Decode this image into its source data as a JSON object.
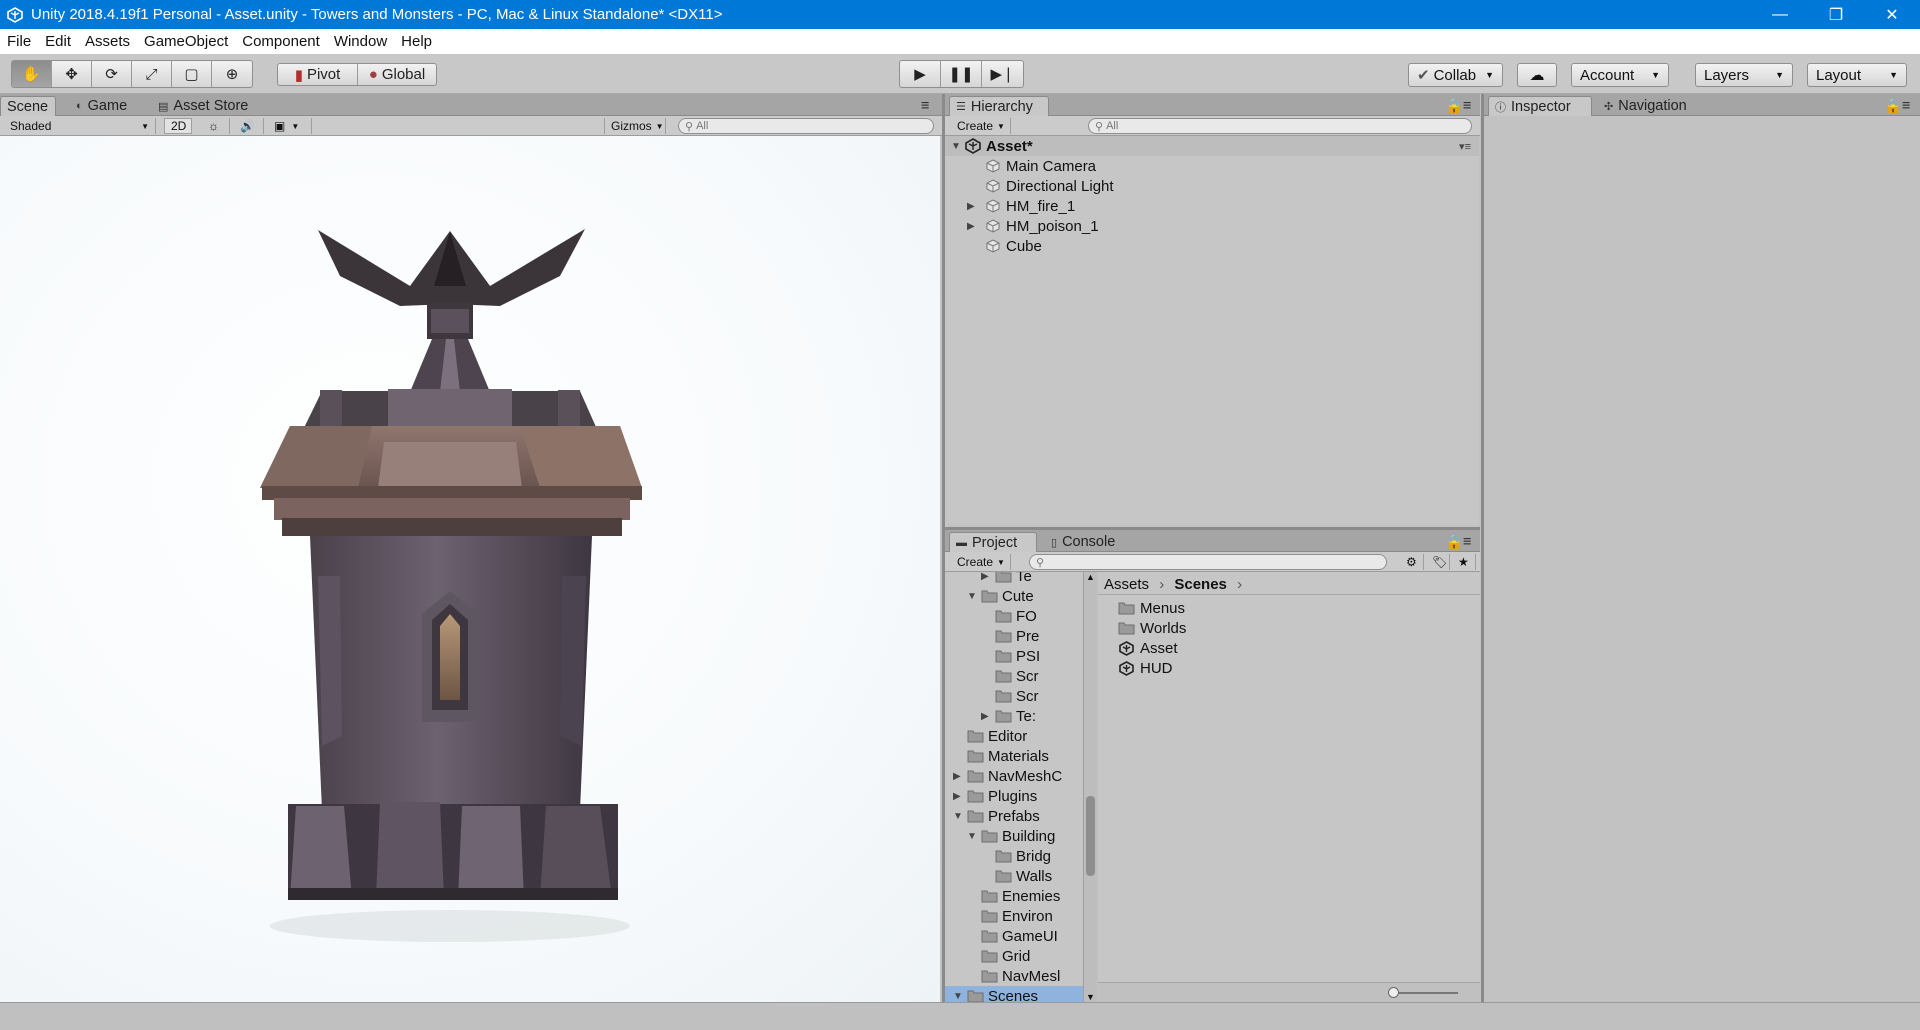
{
  "window": {
    "title": "Unity 2018.4.19f1 Personal - Asset.unity - Towers and Monsters - PC, Mac & Linux Standalone* <DX11>",
    "minimize": "—",
    "maximize": "❐",
    "close": "✕"
  },
  "menu": [
    "File",
    "Edit",
    "Assets",
    "GameObject",
    "Component",
    "Window",
    "Help"
  ],
  "toolbar": {
    "pivot": "Pivot",
    "global": "Global",
    "collab": "Collab",
    "account": "Account",
    "layers": "Layers",
    "layout": "Layout"
  },
  "scene_panel": {
    "tabs": [
      "Scene",
      "Game",
      "Asset Store"
    ],
    "shading_mode": "Shaded",
    "mode_2d": "2D",
    "gizmos": "Gizmos",
    "search_placeholder": "All"
  },
  "hierarchy": {
    "tab": "Hierarchy",
    "create": "Create",
    "search_placeholder": "All",
    "scene": "Asset*",
    "items": [
      {
        "label": "Main Camera",
        "expandable": false
      },
      {
        "label": "Directional Light",
        "expandable": false
      },
      {
        "label": "HM_fire_1",
        "expandable": true
      },
      {
        "label": "HM_poison_1",
        "expandable": true
      },
      {
        "label": "Cube",
        "expandable": false
      }
    ]
  },
  "inspector": {
    "tabs": [
      "Inspector",
      "Navigation"
    ]
  },
  "project": {
    "tabs": [
      "Project",
      "Console"
    ],
    "create": "Create",
    "tree": [
      {
        "label": "Te",
        "depth": 3,
        "arrow": "right"
      },
      {
        "label": "Cute",
        "depth": 2,
        "arrow": "down"
      },
      {
        "label": "FO",
        "depth": 3,
        "arrow": ""
      },
      {
        "label": "Pre",
        "depth": 3,
        "arrow": ""
      },
      {
        "label": "PSI",
        "depth": 3,
        "arrow": ""
      },
      {
        "label": "Scr",
        "depth": 3,
        "arrow": ""
      },
      {
        "label": "Scr",
        "depth": 3,
        "arrow": ""
      },
      {
        "label": "Te:",
        "depth": 3,
        "arrow": "right"
      },
      {
        "label": "Editor",
        "depth": 1,
        "arrow": ""
      },
      {
        "label": "Materials",
        "depth": 1,
        "arrow": ""
      },
      {
        "label": "NavMeshC",
        "depth": 1,
        "arrow": "right"
      },
      {
        "label": "Plugins",
        "depth": 1,
        "arrow": "right"
      },
      {
        "label": "Prefabs",
        "depth": 1,
        "arrow": "down"
      },
      {
        "label": "Building",
        "depth": 2,
        "arrow": "down"
      },
      {
        "label": "Bridg",
        "depth": 3,
        "arrow": ""
      },
      {
        "label": "Walls",
        "depth": 3,
        "arrow": ""
      },
      {
        "label": "Enemies",
        "depth": 2,
        "arrow": ""
      },
      {
        "label": "Environ",
        "depth": 2,
        "arrow": ""
      },
      {
        "label": "GameUI",
        "depth": 2,
        "arrow": ""
      },
      {
        "label": "Grid",
        "depth": 2,
        "arrow": ""
      },
      {
        "label": "NavMesl",
        "depth": 2,
        "arrow": ""
      },
      {
        "label": "Scenes",
        "depth": 1,
        "arrow": "down",
        "selected": true
      }
    ],
    "breadcrumb": [
      "Assets",
      "Scenes"
    ],
    "files": [
      {
        "label": "Menus",
        "type": "folder"
      },
      {
        "label": "Worlds",
        "type": "folder"
      },
      {
        "label": "Asset",
        "type": "scene"
      },
      {
        "label": "HUD",
        "type": "scene"
      }
    ]
  }
}
